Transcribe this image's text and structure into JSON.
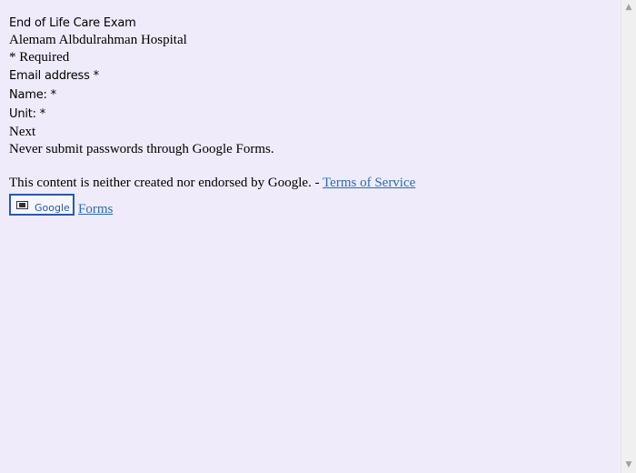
{
  "form": {
    "title": "End of Life Care Exam",
    "organization": "Alemam Albdulrahman Hospital",
    "required_note": "* Required",
    "fields": [
      {
        "label": "Email address *"
      },
      {
        "label": "Name: *"
      },
      {
        "label": "Unit: *"
      }
    ],
    "next_label": "Next",
    "password_warning": "Never submit passwords through Google Forms."
  },
  "footer": {
    "disclaimer": "This content is neither created nor endorsed by Google. - ",
    "terms_link": "Terms of Service",
    "logo_text": "Google",
    "forms_link": "Forms"
  },
  "scrollbar": {
    "up_arrow": "▲",
    "down_arrow": "▼"
  }
}
